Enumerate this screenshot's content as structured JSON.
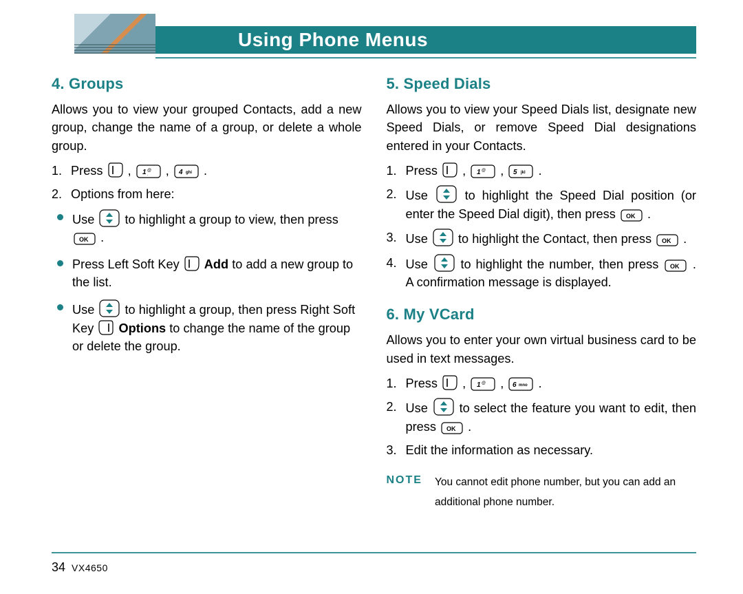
{
  "header": {
    "title": "Using Phone Menus"
  },
  "footer": {
    "page": "34",
    "model": "VX4650"
  },
  "left": {
    "section_title": "4. Groups",
    "lead": "Allows you to view your grouped Contacts, add a new group, change the name of a group, or delete a whole group.",
    "step1_prefix": "Press ",
    "step2": "Options from here:",
    "b1a": "Use ",
    "b1b": " to highlight a group to view, then press ",
    "b1c": " .",
    "b2a": "Press Left Soft Key ",
    "b2b": " to add a new group to the list.",
    "b2_bold": "Add",
    "b3a": "Use ",
    "b3b": " to highlight a group, then press Right Soft Key ",
    "b3c": " to change the name of the group or delete the group.",
    "b3_bold": "Options"
  },
  "right": {
    "speed_title": "5. Speed Dials",
    "speed_lead": "Allows you to view your Speed Dials list, designate new Speed Dials, or remove Speed Dial designations entered in your Contacts.",
    "sd1_prefix": "Press ",
    "sd2a": "Use ",
    "sd2b": " to highlight the Speed Dial position (or enter the Speed Dial digit), then press ",
    "sd2c": " .",
    "sd3a": "Use ",
    "sd3b": " to highlight the Contact, then press ",
    "sd3c": " .",
    "sd4a": "Use ",
    "sd4b": " to highlight the number, then press ",
    "sd4c": " . A confirmation message is displayed.",
    "vcard_title": "6. My VCard",
    "vcard_lead": "Allows you to enter your own virtual business card to be used in text messages.",
    "vc1_prefix": "Press ",
    "vc2a": "Use ",
    "vc2b": " to select the feature you want to edit, then press ",
    "vc2c": " .",
    "vc3": "Edit the information as necessary.",
    "note_label": "NOTE",
    "note_text": "You cannot edit phone number, but you can add an additional phone number."
  },
  "keys": {
    "k1_label": "1",
    "k4_label": "4 ghi",
    "k5_label": "5 jkl",
    "k6_label": "6mno",
    "ok_label": "OK"
  }
}
